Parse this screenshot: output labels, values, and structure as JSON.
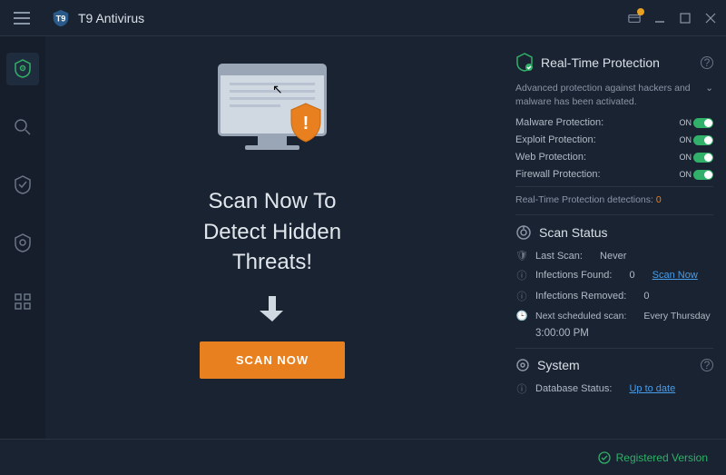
{
  "titlebar": {
    "app_name": "T9 Antivirus"
  },
  "hero": {
    "line1": "Scan Now To",
    "line2": "Detect Hidden",
    "line3": "Threats!",
    "scan_button": "SCAN NOW"
  },
  "rtp": {
    "title": "Real-Time Protection",
    "description": "Advanced protection against hackers and malware has been activated.",
    "rows": {
      "malware": "Malware Protection:",
      "exploit": "Exploit Protection:",
      "web": "Web Protection:",
      "firewall": "Firewall Protection:"
    },
    "on_label": "ON",
    "detections_label": "Real-Time Protection detections:",
    "detections_count": "0"
  },
  "scan_status": {
    "title": "Scan Status",
    "last_scan_label": "Last Scan:",
    "last_scan_value": "Never",
    "infections_found_label": "Infections Found:",
    "infections_found_value": "0",
    "scan_now_link": "Scan Now",
    "infections_removed_label": "Infections Removed:",
    "infections_removed_value": "0",
    "next_scan_label": "Next scheduled scan:",
    "next_scan_value": "Every Thursday",
    "next_scan_time": "3:00:00 PM"
  },
  "system": {
    "title": "System",
    "db_label": "Database Status:",
    "db_value": "Up to date"
  },
  "footer": {
    "version": "Registered Version"
  }
}
